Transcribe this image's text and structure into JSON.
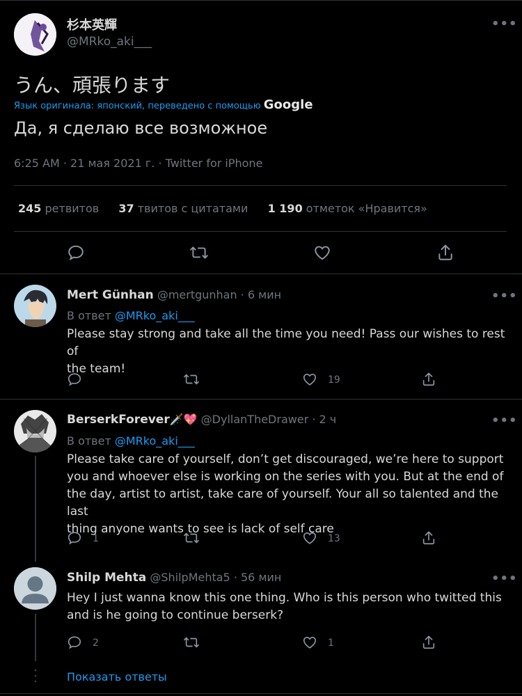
{
  "main_tweet": {
    "display_name": "杉本英輝",
    "handle": "@MRko_aki___",
    "text": "うん、頑張ります",
    "translation_note": "Язык оригинала: японский, переведено с помощью",
    "translation_brand": "Google",
    "translation": "Да, я сделаю все возможное",
    "timestamp": "6:25 AM · 21 мая 2021 г. · Twitter for iPhone",
    "stats": {
      "retweets_count": "245",
      "retweets_label": "ретвитов",
      "quotes_count": "37",
      "quotes_label": "твитов с цитатами",
      "likes_count": "1 190",
      "likes_label": "отметок «Нравится»"
    },
    "more_label": "•••"
  },
  "replies": [
    {
      "display_name": "Mert Günhan",
      "handle": "@mertgunhan",
      "time": "· 6 мин",
      "reply_prefix": "В ответ",
      "reply_to": "@MRko_aki___",
      "text_lines": [
        "Please stay strong and take all the time you need! Pass our wishes to rest of",
        "the team!"
      ],
      "reply_count": "",
      "like_count": "19",
      "more_label": "•••"
    },
    {
      "display_name": "BerserkForever",
      "name_emoji": "🗡️💖",
      "handle": "@DyllanTheDrawer",
      "time": "· 2 ч",
      "reply_prefix": "В ответ",
      "reply_to": "@MRko_aki___",
      "text_lines": [
        "Please take care of yourself, don’t get discouraged, we’re here to support",
        "you and whoever else is working on the series with you. But at the end of",
        "the day, artist to artist, take care of yourself. Your all so talented and the last",
        "thing anyone wants to see is lack of self care"
      ],
      "reply_count": "1",
      "like_count": "13",
      "more_label": "•••"
    },
    {
      "display_name": "Shilp Mehta",
      "handle": "@ShilpMehta5",
      "time": "· 56 мин",
      "text_lines": [
        "Hey I just wanna know this one thing. Who is this person who twitted this",
        "and is he going to continue berserk?"
      ],
      "reply_count": "2",
      "like_count": "1",
      "more_label": "•••"
    }
  ],
  "show_replies": "Показать ответы",
  "colors": {
    "background": "#000000",
    "text": "#d9d9d9",
    "muted": "#6e767d",
    "link": "#1d9bf0",
    "divider": "#2f3336"
  },
  "icons": [
    "reply-icon",
    "retweet-icon",
    "like-icon",
    "share-icon",
    "more-icon"
  ]
}
